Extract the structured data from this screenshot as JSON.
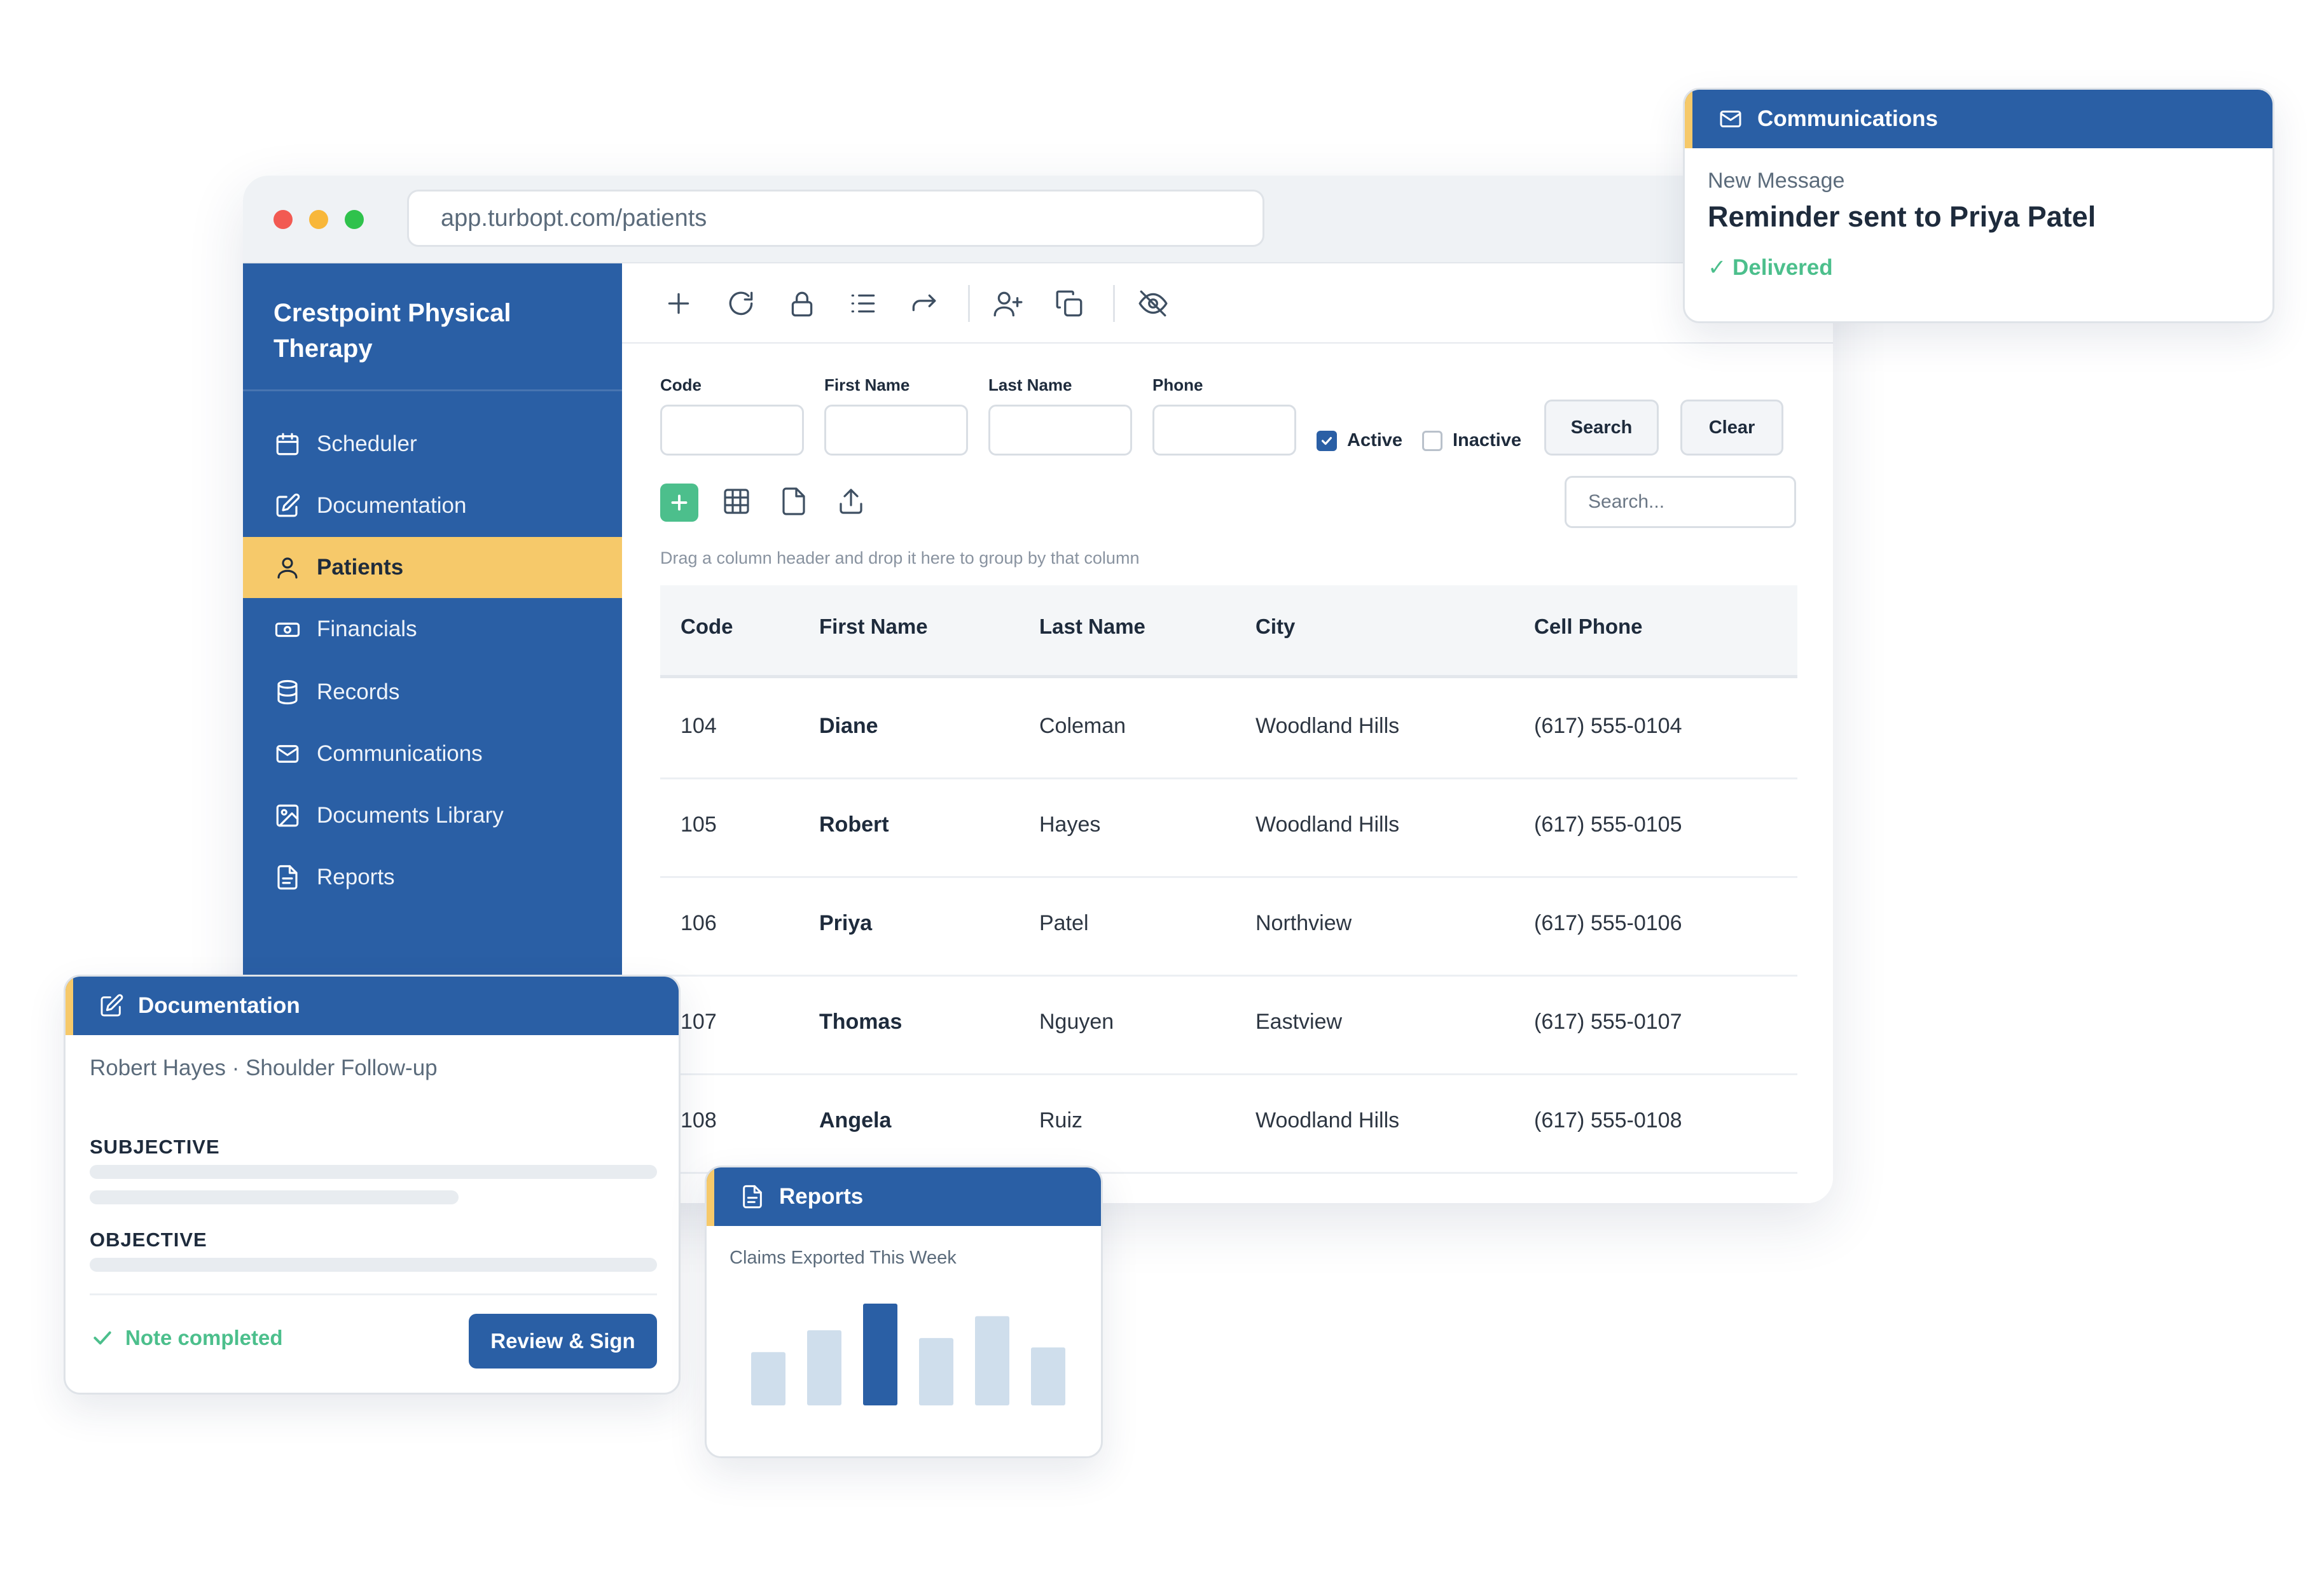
{
  "browser": {
    "url": "app.turbopt.com/patients"
  },
  "sidebar": {
    "brand": "Crestpoint Physical Therapy",
    "items": [
      {
        "label": "Scheduler",
        "icon": "calendar-icon"
      },
      {
        "label": "Documentation",
        "icon": "edit-icon"
      },
      {
        "label": "Patients",
        "icon": "user-icon",
        "active": true
      },
      {
        "label": "Financials",
        "icon": "money-icon"
      },
      {
        "label": "Records",
        "icon": "database-icon"
      },
      {
        "label": "Communications",
        "icon": "mail-icon"
      },
      {
        "label": "Documents Library",
        "icon": "image-icon"
      },
      {
        "label": "Reports",
        "icon": "file-icon"
      }
    ]
  },
  "toolbar": {
    "icons": [
      "plus-icon",
      "refresh-icon",
      "lock-icon",
      "list-icon",
      "redo-icon",
      "add-user-icon",
      "copy-icon",
      "eye-off-icon"
    ]
  },
  "filters": {
    "code_label": "Code",
    "first_name_label": "First Name",
    "last_name_label": "Last Name",
    "phone_label": "Phone",
    "active_label": "Active",
    "active_checked": true,
    "inactive_label": "Inactive",
    "inactive_checked": false,
    "search_button": "Search",
    "clear_button": "Clear"
  },
  "grid": {
    "search_placeholder": "Search...",
    "group_hint": "Drag a column header and drop it here to group by that column",
    "columns": [
      "Code",
      "First Name",
      "Last Name",
      "City",
      "Cell Phone"
    ],
    "rows": [
      {
        "code": "104",
        "first": "Diane",
        "last": "Coleman",
        "city": "Woodland Hills",
        "phone": "(617) 555-0104"
      },
      {
        "code": "105",
        "first": "Robert",
        "last": "Hayes",
        "city": "Woodland Hills",
        "phone": "(617) 555-0105"
      },
      {
        "code": "106",
        "first": "Priya",
        "last": "Patel",
        "city": "Northview",
        "phone": "(617) 555-0106"
      },
      {
        "code": "107",
        "first": "Thomas",
        "last": "Nguyen",
        "city": "Eastview",
        "phone": "(617) 555-0107"
      },
      {
        "code": "108",
        "first": "Angela",
        "last": "Ruiz",
        "city": "Woodland Hills",
        "phone": "(617) 555-0108"
      }
    ]
  },
  "communications_card": {
    "title": "Communications",
    "subtitle": "New Message",
    "message": "Reminder sent to Priya Patel",
    "status": "✓ Delivered"
  },
  "documentation_card": {
    "title": "Documentation",
    "subtitle": "Robert Hayes · Shoulder Follow-up",
    "section1": "SUBJECTIVE",
    "section2": "OBJECTIVE",
    "status": "Note completed",
    "button": "Review & Sign"
  },
  "reports_card": {
    "title": "Reports",
    "subtitle": "Claims Exported This Week"
  },
  "chart_data": {
    "type": "bar",
    "title": "Claims Exported This Week",
    "values": [
      34,
      48,
      65,
      43,
      57,
      37
    ],
    "highlight_index": 2,
    "colors": {
      "bar": "#cfdeec",
      "highlight": "#2a5fa5"
    }
  },
  "colors": {
    "primary": "#2a5fa5",
    "accent": "#f6c96a",
    "success": "#4cbf8c"
  }
}
